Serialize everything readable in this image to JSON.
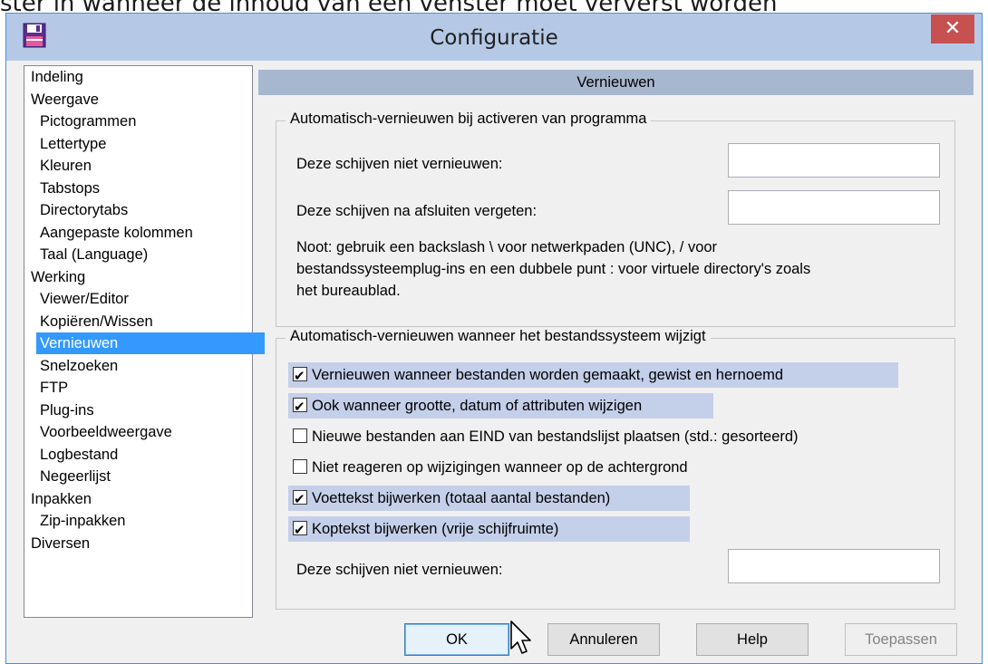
{
  "caption_text": "ster in wanneer de inhoud van een venster moet ververst worden",
  "window": {
    "title": "Configuratie",
    "close_label": "✕"
  },
  "sidebar": {
    "items": [
      {
        "label": "Indeling",
        "level": 0,
        "selected": false
      },
      {
        "label": "Weergave",
        "level": 0,
        "selected": false
      },
      {
        "label": "Pictogrammen",
        "level": 1,
        "selected": false
      },
      {
        "label": "Lettertype",
        "level": 1,
        "selected": false
      },
      {
        "label": "Kleuren",
        "level": 1,
        "selected": false
      },
      {
        "label": "Tabstops",
        "level": 1,
        "selected": false
      },
      {
        "label": "Directorytabs",
        "level": 1,
        "selected": false
      },
      {
        "label": "Aangepaste kolommen",
        "level": 1,
        "selected": false
      },
      {
        "label": "Taal (Language)",
        "level": 1,
        "selected": false
      },
      {
        "label": "Werking",
        "level": 0,
        "selected": false
      },
      {
        "label": "Viewer/Editor",
        "level": 1,
        "selected": false
      },
      {
        "label": "Kopiëren/Wissen",
        "level": 1,
        "selected": false
      },
      {
        "label": "Vernieuwen",
        "level": 1,
        "selected": true
      },
      {
        "label": "Snelzoeken",
        "level": 1,
        "selected": false
      },
      {
        "label": "FTP",
        "level": 1,
        "selected": false
      },
      {
        "label": "Plug-ins",
        "level": 1,
        "selected": false
      },
      {
        "label": "Voorbeeldweergave",
        "level": 1,
        "selected": false
      },
      {
        "label": "Logbestand",
        "level": 1,
        "selected": false
      },
      {
        "label": "Negeerlijst",
        "level": 1,
        "selected": false
      },
      {
        "label": "Inpakken",
        "level": 0,
        "selected": false
      },
      {
        "label": "Zip-inpakken",
        "level": 1,
        "selected": false
      },
      {
        "label": "Diversen",
        "level": 0,
        "selected": false
      }
    ]
  },
  "main": {
    "section_title": "Vernieuwen",
    "group1": {
      "legend": "Automatisch-vernieuwen bij activeren van programma",
      "row1_label": "Deze schijven niet vernieuwen:",
      "row1_value": "",
      "row2_label": "Deze schijven na afsluiten vergeten:",
      "row2_value": "",
      "note_line1": "Noot: gebruik een backslash \\ voor netwerkpaden (UNC), / voor",
      "note_line2": "bestandssysteemplug-ins en een dubbele punt : voor virtuele directory's zoals",
      "note_line3": "het bureaublad."
    },
    "group2": {
      "legend": "Automatisch-vernieuwen wanneer het bestandssysteem wijzigt",
      "checkboxes": [
        {
          "label": "Vernieuwen wanneer bestanden worden gemaakt, gewist en hernoemd",
          "checked": true
        },
        {
          "label": "Ook wanneer grootte, datum of attributen wijzigen",
          "checked": true
        },
        {
          "label": "Nieuwe bestanden aan EIND van bestandslijst plaatsen (std.: gesorteerd)",
          "checked": false
        },
        {
          "label": "Niet reageren op wijzigingen wanneer op de achtergrond",
          "checked": false
        },
        {
          "label": "Voettekst bijwerken (totaal aantal bestanden)",
          "checked": true
        },
        {
          "label": "Koptekst bijwerken (vrije schijfruimte)",
          "checked": true
        }
      ],
      "row_label": "Deze schijven niet vernieuwen:",
      "row_value": ""
    }
  },
  "buttons": {
    "ok": "OK",
    "cancel": "Annuleren",
    "help": "Help",
    "apply": "Toepassen"
  },
  "colors": {
    "title_bar": "#b5c9e6",
    "close_button": "#c75050",
    "section_header": "#a7b7cf",
    "selection": "#3399ff",
    "checked_highlight": "#c4cfea"
  }
}
